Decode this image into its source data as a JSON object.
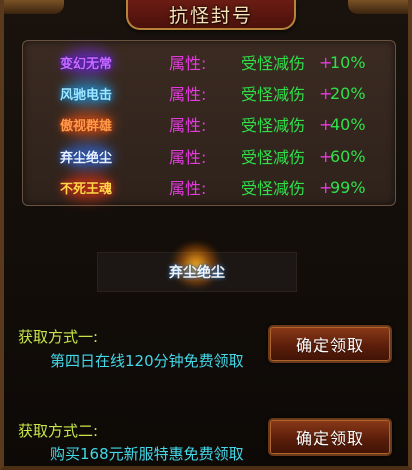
{
  "window": {
    "title": "抗怪封号"
  },
  "titles_list": [
    {
      "name": "变幻无常",
      "attr": "属性:",
      "effect": "受怪减伤",
      "plus": "+",
      "pct": "10%",
      "name_color": "#c86cff",
      "glow_color": "#7a2cff"
    },
    {
      "name": "风驰电击",
      "attr": "属性:",
      "effect": "受怪减伤",
      "plus": "+",
      "pct": "20%",
      "name_color": "#9fe8ff",
      "glow_color": "#2aa8ff"
    },
    {
      "name": "傲视群雄",
      "attr": "属性:",
      "effect": "受怪减伤",
      "plus": "+",
      "pct": "40%",
      "name_color": "#ff9a4a",
      "glow_color": "#ff5a1a"
    },
    {
      "name": "弃尘绝尘",
      "attr": "属性:",
      "effect": "受怪减伤",
      "plus": "+",
      "pct": "60%",
      "name_color": "#e8f0ff",
      "glow_color": "#3a7aff"
    },
    {
      "name": "不死王魂",
      "attr": "属性:",
      "effect": "受怪减伤",
      "plus": "+",
      "pct": "99%",
      "name_color": "#ffd84a",
      "glow_color": "#ff3a1a"
    }
  ],
  "preview": {
    "name": "弃尘绝尘"
  },
  "acquire": [
    {
      "label": "获取方式一:",
      "desc": "第四日在线120分钟免费领取",
      "button": "确定领取"
    },
    {
      "label": "获取方式二:",
      "desc": "购买168元新服特惠免费领取",
      "button": "确定领取"
    }
  ]
}
